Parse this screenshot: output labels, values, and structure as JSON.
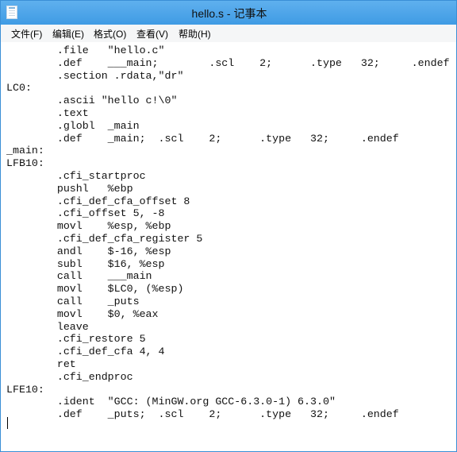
{
  "window": {
    "title": "hello.s - 记事本"
  },
  "menubar": {
    "items": [
      "文件(F)",
      "编辑(E)",
      "格式(O)",
      "查看(V)",
      "帮助(H)"
    ]
  },
  "editor": {
    "lines": [
      "        .file   \"hello.c\"",
      "        .def    ___main;        .scl    2;      .type   32;     .endef",
      "        .section .rdata,\"dr\"",
      "LC0:",
      "        .ascii \"hello c!\\0\"",
      "        .text",
      "        .globl  _main",
      "        .def    _main;  .scl    2;      .type   32;     .endef",
      "_main:",
      "LFB10:",
      "        .cfi_startproc",
      "        pushl   %ebp",
      "        .cfi_def_cfa_offset 8",
      "        .cfi_offset 5, -8",
      "        movl    %esp, %ebp",
      "        .cfi_def_cfa_register 5",
      "        andl    $-16, %esp",
      "        subl    $16, %esp",
      "        call    ___main",
      "        movl    $LC0, (%esp)",
      "        call    _puts",
      "        movl    $0, %eax",
      "        leave",
      "        .cfi_restore 5",
      "        .cfi_def_cfa 4, 4",
      "        ret",
      "        .cfi_endproc",
      "LFE10:",
      "        .ident  \"GCC: (MinGW.org GCC-6.3.0-1) 6.3.0\"",
      "        .def    _puts;  .scl    2;      .type   32;     .endef"
    ]
  }
}
